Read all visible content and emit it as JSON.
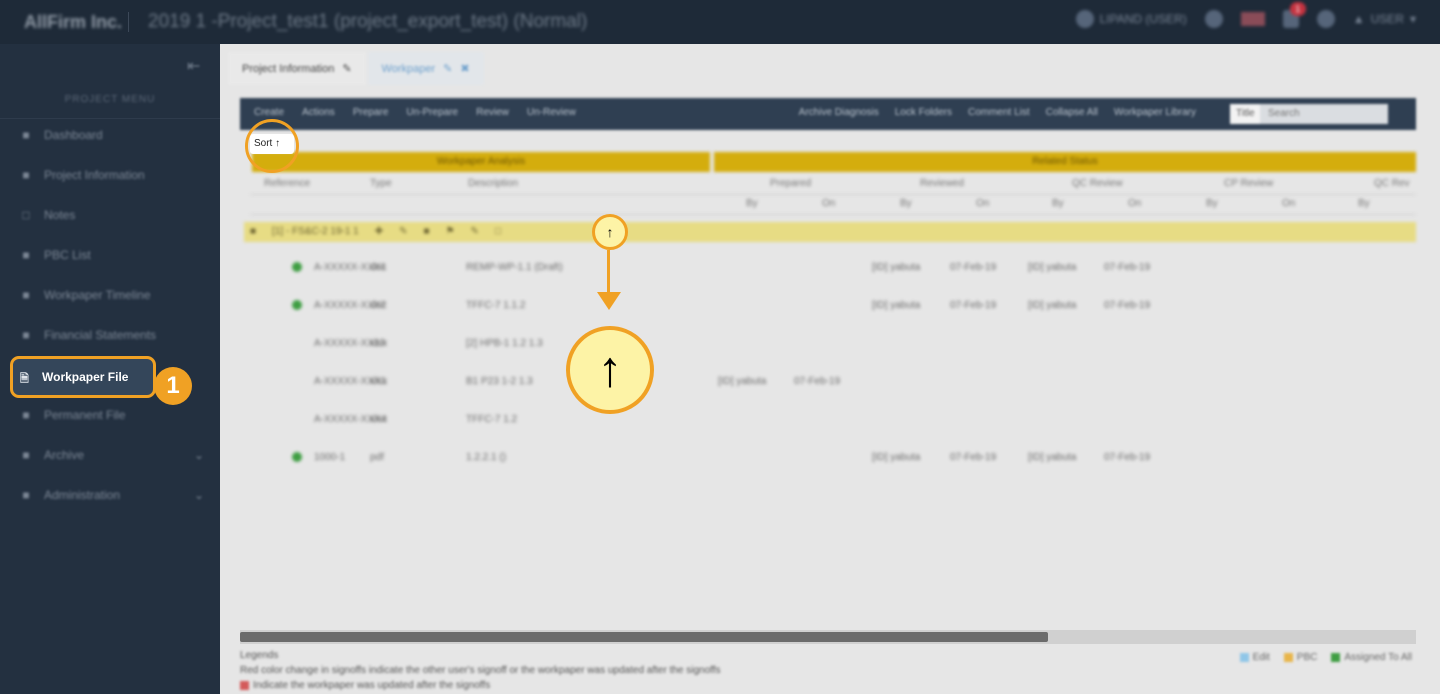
{
  "topbar": {
    "brand": "AllFirm Inc.",
    "project_title": "2019 1 -Project_test1 (project_export_test) (Normal)",
    "user_chip": "LIPAND (USER)",
    "notification_count": "1",
    "user_menu": "USER"
  },
  "sidebar": {
    "project_label": "PROJECT MENU",
    "items": [
      {
        "label": "Dashboard"
      },
      {
        "label": "Project Information"
      },
      {
        "label": "Notes"
      },
      {
        "label": "PBC List"
      },
      {
        "label": "Workpaper Timeline"
      },
      {
        "label": "Financial Statements"
      },
      {
        "label": "Workpaper File"
      },
      {
        "label": "Permanent File"
      },
      {
        "label": "Archive"
      },
      {
        "label": "Administration"
      }
    ],
    "active_item": "Workpaper File",
    "step_number": "1"
  },
  "tabs": [
    {
      "label": "Project Information"
    },
    {
      "label": "Workpaper"
    }
  ],
  "toolbar": {
    "left_items": [
      "Create",
      "Actions",
      "Prepare",
      "Un-Prepare",
      "Review",
      "Un-Review"
    ],
    "right_items": [
      "Archive Diagnosis",
      "Lock Folders",
      "Comment List",
      "Collapse All",
      "Workpaper Library"
    ],
    "filter_value": "Title",
    "search_placeholder": "Search"
  },
  "table": {
    "band_left": "Workpaper Analysis",
    "band_right": "Related Status",
    "columns": [
      "Reference",
      "Type",
      "Description",
      "Prepared",
      "Reviewed",
      "QC Review",
      "CP Review",
      "QC Rev"
    ],
    "subcolumns": [
      "By",
      "On",
      "By",
      "On",
      "By",
      "On",
      "By",
      "On",
      "By"
    ],
    "group_title": "[1] - FS&C-2 19-1 1",
    "rows": [
      {
        "status": "green",
        "ref": "A-XXXXX-XXX1",
        "type": "doc",
        "desc": "REMP-WP-1.1 (Draft)",
        "prep_by": "",
        "prep_on": "",
        "rev_by": "[ID] yabuta",
        "rev_on": "07-Feb-19",
        "qc_by": "[ID] yabuta",
        "qc_on": "07-Feb-19"
      },
      {
        "status": "green",
        "ref": "A-XXXXX-XXX2",
        "type": "doc",
        "desc": "TFFC-7 1.1.2",
        "prep_by": "",
        "prep_on": "",
        "rev_by": "[ID] yabuta",
        "rev_on": "07-Feb-19",
        "qc_by": "[ID] yabuta",
        "qc_on": "07-Feb-19"
      },
      {
        "status": "none",
        "ref": "A-XXXXX-XX13",
        "type": "xlsx",
        "desc": "[2] HPB-1 1.2 1.3",
        "prep_by": "",
        "prep_on": "",
        "rev_by": "",
        "rev_on": "",
        "qc_by": "",
        "qc_on": ""
      },
      {
        "status": "none",
        "ref": "A-XXXXX-XXX1",
        "type": "xlsx",
        "desc": "B1 P23 1-2 1.3",
        "prep_by": "[ID] yabuta",
        "prep_on": "07-Feb-19",
        "rev_by": "",
        "rev_on": "",
        "qc_by": "",
        "qc_on": ""
      },
      {
        "status": "none",
        "ref": "A-XXXXX-XXX4",
        "type": "xlsx",
        "desc": "TFFC-7 1.2",
        "prep_by": "",
        "prep_on": "",
        "rev_by": "",
        "rev_on": "",
        "qc_by": "",
        "qc_on": ""
      },
      {
        "status": "green",
        "ref": "1000-1",
        "type": "pdf",
        "desc": "1.2.2.1 ()",
        "prep_by": "",
        "prep_on": "",
        "rev_by": "[ID] yabuta",
        "rev_on": "07-Feb-19",
        "qc_by": "[ID] yabuta",
        "qc_on": "07-Feb-19"
      }
    ]
  },
  "sort_callout": {
    "label": "Sort",
    "arrow": "↑"
  },
  "legend": {
    "title": "Legends",
    "line1": "Red color change in signoffs indicate the other user's signoff or the workpaper was updated after the signoffs",
    "line2": "Indicate the workpaper was updated after the signoffs",
    "right_items": [
      {
        "label": "Edit",
        "color": "#8fc6e8"
      },
      {
        "label": "PBC",
        "color": "#e8b54a"
      },
      {
        "label": "Assigned To All",
        "color": "#3f9e43"
      }
    ]
  },
  "colors": {
    "accent": "#f0a124",
    "sidebar": "#233040",
    "topbar": "#1e2a38",
    "header_band": "#d4ad0d",
    "group_row": "#e7dc84"
  }
}
